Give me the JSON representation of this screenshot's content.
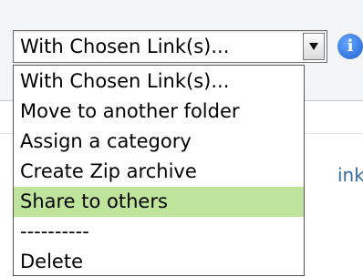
{
  "select": {
    "value": "With Chosen Link(s)...",
    "info_icon": "info-icon"
  },
  "menu": {
    "items": [
      {
        "label": "With Chosen Link(s)...",
        "selected": false
      },
      {
        "label": "Move to another folder",
        "selected": false
      },
      {
        "label": "Assign a category",
        "selected": false
      },
      {
        "label": "Create Zip archive",
        "selected": false
      },
      {
        "label": "Share to others",
        "selected": true
      },
      {
        "label": "----------",
        "selected": false
      },
      {
        "label": "Delete",
        "selected": false
      }
    ],
    "highlight_color": "#bfe49b"
  },
  "background": {
    "link_fragment": "ink"
  }
}
